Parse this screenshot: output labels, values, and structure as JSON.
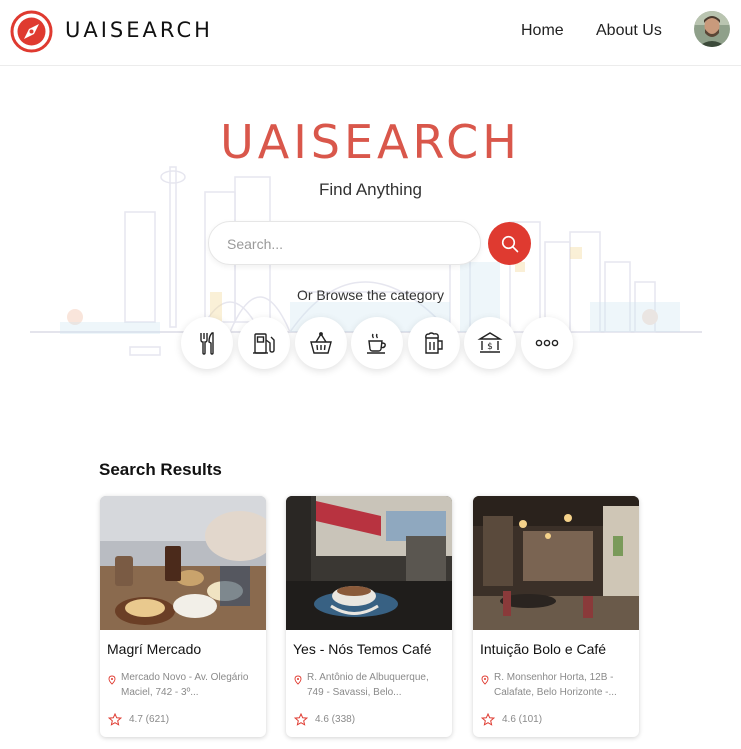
{
  "header": {
    "brand": "UAISEARCH",
    "nav": [
      {
        "label": "Home"
      },
      {
        "label": "About Us"
      }
    ]
  },
  "hero": {
    "title": "UAISEARCH",
    "subtitle": "Find Anything",
    "search_placeholder": "Search...",
    "browse_label": "Or Browse the category",
    "categories": [
      {
        "icon": "fork-knife-icon"
      },
      {
        "icon": "fuel-pump-icon"
      },
      {
        "icon": "shopping-basket-icon"
      },
      {
        "icon": "coffee-cup-icon"
      },
      {
        "icon": "beer-mug-icon"
      },
      {
        "icon": "bank-icon"
      },
      {
        "icon": "more-icon"
      }
    ]
  },
  "results": {
    "title": "Search Results",
    "items": [
      {
        "name": "Magrí Mercado",
        "address": "Mercado Novo - Av. Olegário Maciel, 742 - 3º...",
        "rating": "4.7 (621)"
      },
      {
        "name": "Yes - Nós Temos Café",
        "address": "R. Antônio de Albuquerque, 749 - Savassi, Belo...",
        "rating": "4.6 (338)"
      },
      {
        "name": "Intuição Bolo e Café",
        "address": "R. Monsenhor Horta, 12B - Calafate, Belo Horizonte -...",
        "rating": "4.6 (101)"
      }
    ]
  },
  "colors": {
    "accent": "#df3a30",
    "title": "#d9574b"
  }
}
